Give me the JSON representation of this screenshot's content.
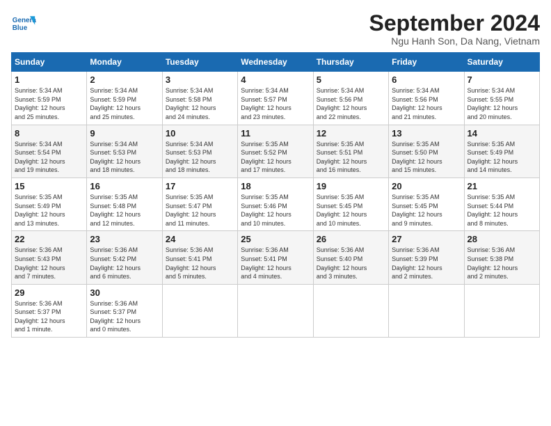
{
  "header": {
    "logo_line1": "General",
    "logo_line2": "Blue",
    "month": "September 2024",
    "location": "Ngu Hanh Son, Da Nang, Vietnam"
  },
  "weekdays": [
    "Sunday",
    "Monday",
    "Tuesday",
    "Wednesday",
    "Thursday",
    "Friday",
    "Saturday"
  ],
  "weeks": [
    [
      {
        "day": "1",
        "info": "Sunrise: 5:34 AM\nSunset: 5:59 PM\nDaylight: 12 hours\nand 25 minutes."
      },
      {
        "day": "2",
        "info": "Sunrise: 5:34 AM\nSunset: 5:59 PM\nDaylight: 12 hours\nand 25 minutes."
      },
      {
        "day": "3",
        "info": "Sunrise: 5:34 AM\nSunset: 5:58 PM\nDaylight: 12 hours\nand 24 minutes."
      },
      {
        "day": "4",
        "info": "Sunrise: 5:34 AM\nSunset: 5:57 PM\nDaylight: 12 hours\nand 23 minutes."
      },
      {
        "day": "5",
        "info": "Sunrise: 5:34 AM\nSunset: 5:56 PM\nDaylight: 12 hours\nand 22 minutes."
      },
      {
        "day": "6",
        "info": "Sunrise: 5:34 AM\nSunset: 5:56 PM\nDaylight: 12 hours\nand 21 minutes."
      },
      {
        "day": "7",
        "info": "Sunrise: 5:34 AM\nSunset: 5:55 PM\nDaylight: 12 hours\nand 20 minutes."
      }
    ],
    [
      {
        "day": "8",
        "info": "Sunrise: 5:34 AM\nSunset: 5:54 PM\nDaylight: 12 hours\nand 19 minutes."
      },
      {
        "day": "9",
        "info": "Sunrise: 5:34 AM\nSunset: 5:53 PM\nDaylight: 12 hours\nand 18 minutes."
      },
      {
        "day": "10",
        "info": "Sunrise: 5:34 AM\nSunset: 5:53 PM\nDaylight: 12 hours\nand 18 minutes."
      },
      {
        "day": "11",
        "info": "Sunrise: 5:35 AM\nSunset: 5:52 PM\nDaylight: 12 hours\nand 17 minutes."
      },
      {
        "day": "12",
        "info": "Sunrise: 5:35 AM\nSunset: 5:51 PM\nDaylight: 12 hours\nand 16 minutes."
      },
      {
        "day": "13",
        "info": "Sunrise: 5:35 AM\nSunset: 5:50 PM\nDaylight: 12 hours\nand 15 minutes."
      },
      {
        "day": "14",
        "info": "Sunrise: 5:35 AM\nSunset: 5:49 PM\nDaylight: 12 hours\nand 14 minutes."
      }
    ],
    [
      {
        "day": "15",
        "info": "Sunrise: 5:35 AM\nSunset: 5:49 PM\nDaylight: 12 hours\nand 13 minutes."
      },
      {
        "day": "16",
        "info": "Sunrise: 5:35 AM\nSunset: 5:48 PM\nDaylight: 12 hours\nand 12 minutes."
      },
      {
        "day": "17",
        "info": "Sunrise: 5:35 AM\nSunset: 5:47 PM\nDaylight: 12 hours\nand 11 minutes."
      },
      {
        "day": "18",
        "info": "Sunrise: 5:35 AM\nSunset: 5:46 PM\nDaylight: 12 hours\nand 10 minutes."
      },
      {
        "day": "19",
        "info": "Sunrise: 5:35 AM\nSunset: 5:45 PM\nDaylight: 12 hours\nand 10 minutes."
      },
      {
        "day": "20",
        "info": "Sunrise: 5:35 AM\nSunset: 5:45 PM\nDaylight: 12 hours\nand 9 minutes."
      },
      {
        "day": "21",
        "info": "Sunrise: 5:35 AM\nSunset: 5:44 PM\nDaylight: 12 hours\nand 8 minutes."
      }
    ],
    [
      {
        "day": "22",
        "info": "Sunrise: 5:36 AM\nSunset: 5:43 PM\nDaylight: 12 hours\nand 7 minutes."
      },
      {
        "day": "23",
        "info": "Sunrise: 5:36 AM\nSunset: 5:42 PM\nDaylight: 12 hours\nand 6 minutes."
      },
      {
        "day": "24",
        "info": "Sunrise: 5:36 AM\nSunset: 5:41 PM\nDaylight: 12 hours\nand 5 minutes."
      },
      {
        "day": "25",
        "info": "Sunrise: 5:36 AM\nSunset: 5:41 PM\nDaylight: 12 hours\nand 4 minutes."
      },
      {
        "day": "26",
        "info": "Sunrise: 5:36 AM\nSunset: 5:40 PM\nDaylight: 12 hours\nand 3 minutes."
      },
      {
        "day": "27",
        "info": "Sunrise: 5:36 AM\nSunset: 5:39 PM\nDaylight: 12 hours\nand 2 minutes."
      },
      {
        "day": "28",
        "info": "Sunrise: 5:36 AM\nSunset: 5:38 PM\nDaylight: 12 hours\nand 2 minutes."
      }
    ],
    [
      {
        "day": "29",
        "info": "Sunrise: 5:36 AM\nSunset: 5:37 PM\nDaylight: 12 hours\nand 1 minute."
      },
      {
        "day": "30",
        "info": "Sunrise: 5:36 AM\nSunset: 5:37 PM\nDaylight: 12 hours\nand 0 minutes."
      },
      {
        "day": "",
        "info": ""
      },
      {
        "day": "",
        "info": ""
      },
      {
        "day": "",
        "info": ""
      },
      {
        "day": "",
        "info": ""
      },
      {
        "day": "",
        "info": ""
      }
    ]
  ]
}
